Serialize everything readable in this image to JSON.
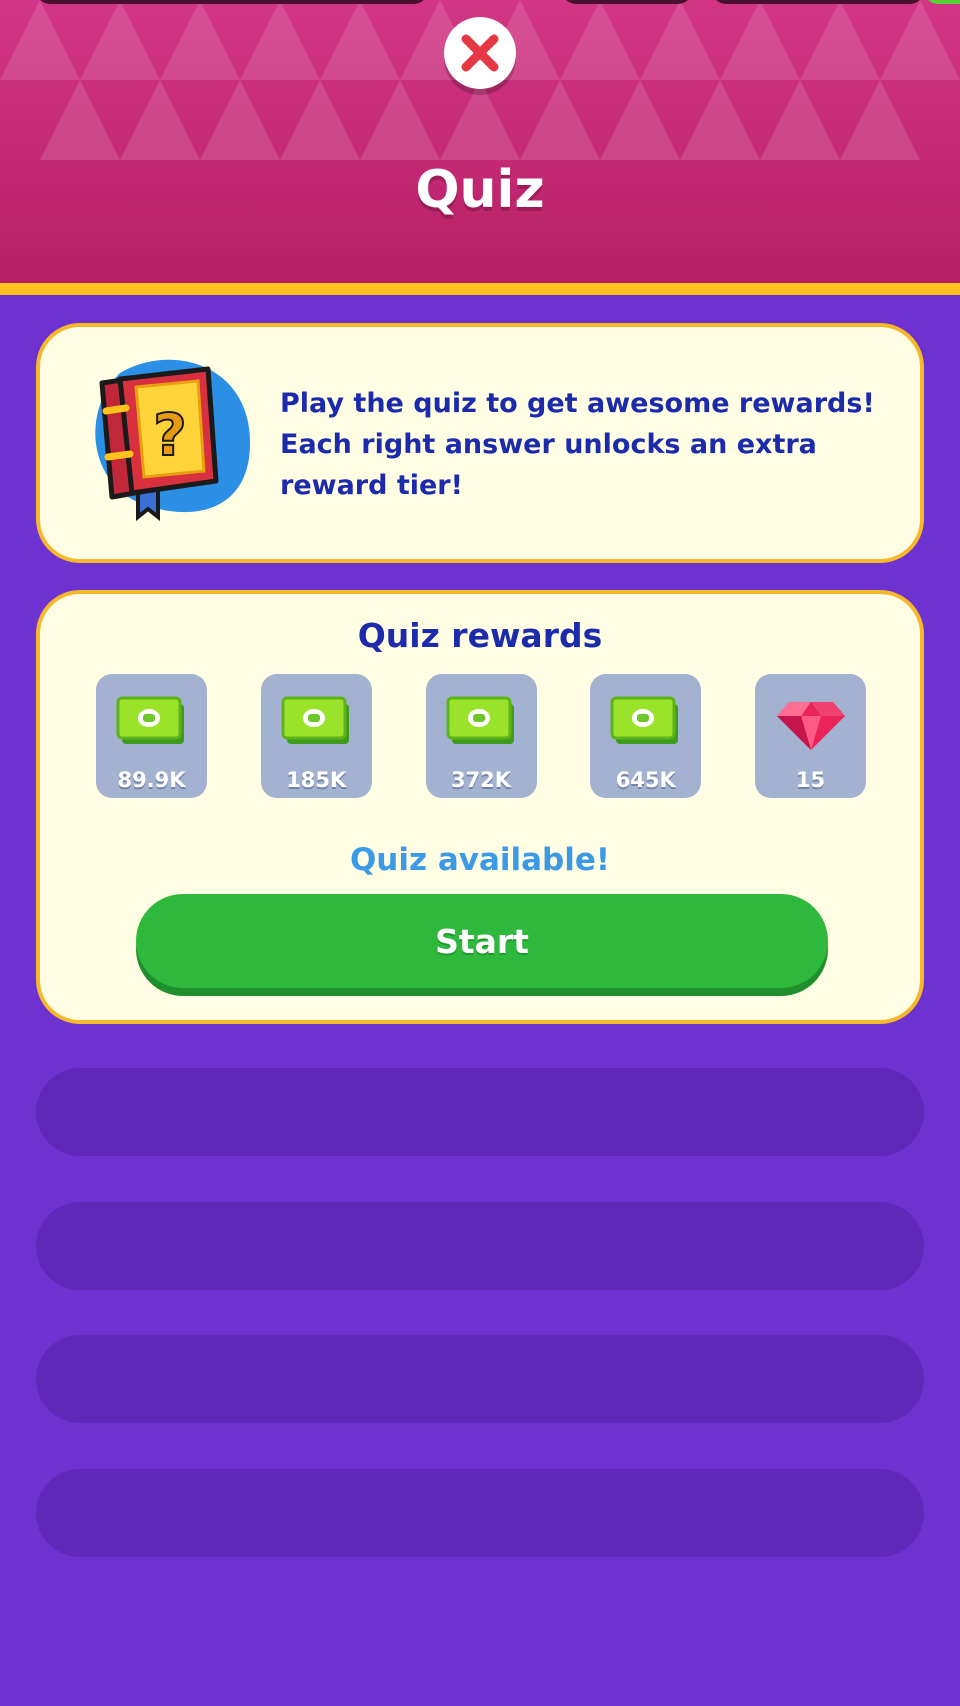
{
  "header": {
    "title": "Quiz",
    "colors": {
      "top": "#d23585",
      "bottom": "#b41e63",
      "stripe": "#ffc21f"
    }
  },
  "close_button": {
    "icon": "close-icon",
    "color": "#e53744"
  },
  "info": {
    "icon": "quiz-book-icon",
    "text": "Play the quiz to get awesome rewards! Each right answer unlocks an extra reward tier!"
  },
  "rewards": {
    "title": "Quiz rewards",
    "items": [
      {
        "icon": "cash-icon",
        "value": "89.9K"
      },
      {
        "icon": "cash-icon",
        "value": "185K"
      },
      {
        "icon": "cash-icon",
        "value": "372K"
      },
      {
        "icon": "cash-icon",
        "value": "645K"
      },
      {
        "icon": "gem-icon",
        "value": "15"
      }
    ],
    "status": "Quiz available!",
    "start_label": "Start"
  },
  "colors": {
    "background": "#6d32cf",
    "card": "#fffde3",
    "card_border": "#f5b82b",
    "text_dark_blue": "#1c2bab",
    "status_blue": "#3b9ae6",
    "start_green": "#2eb93d",
    "slot": "#5e28b8"
  }
}
